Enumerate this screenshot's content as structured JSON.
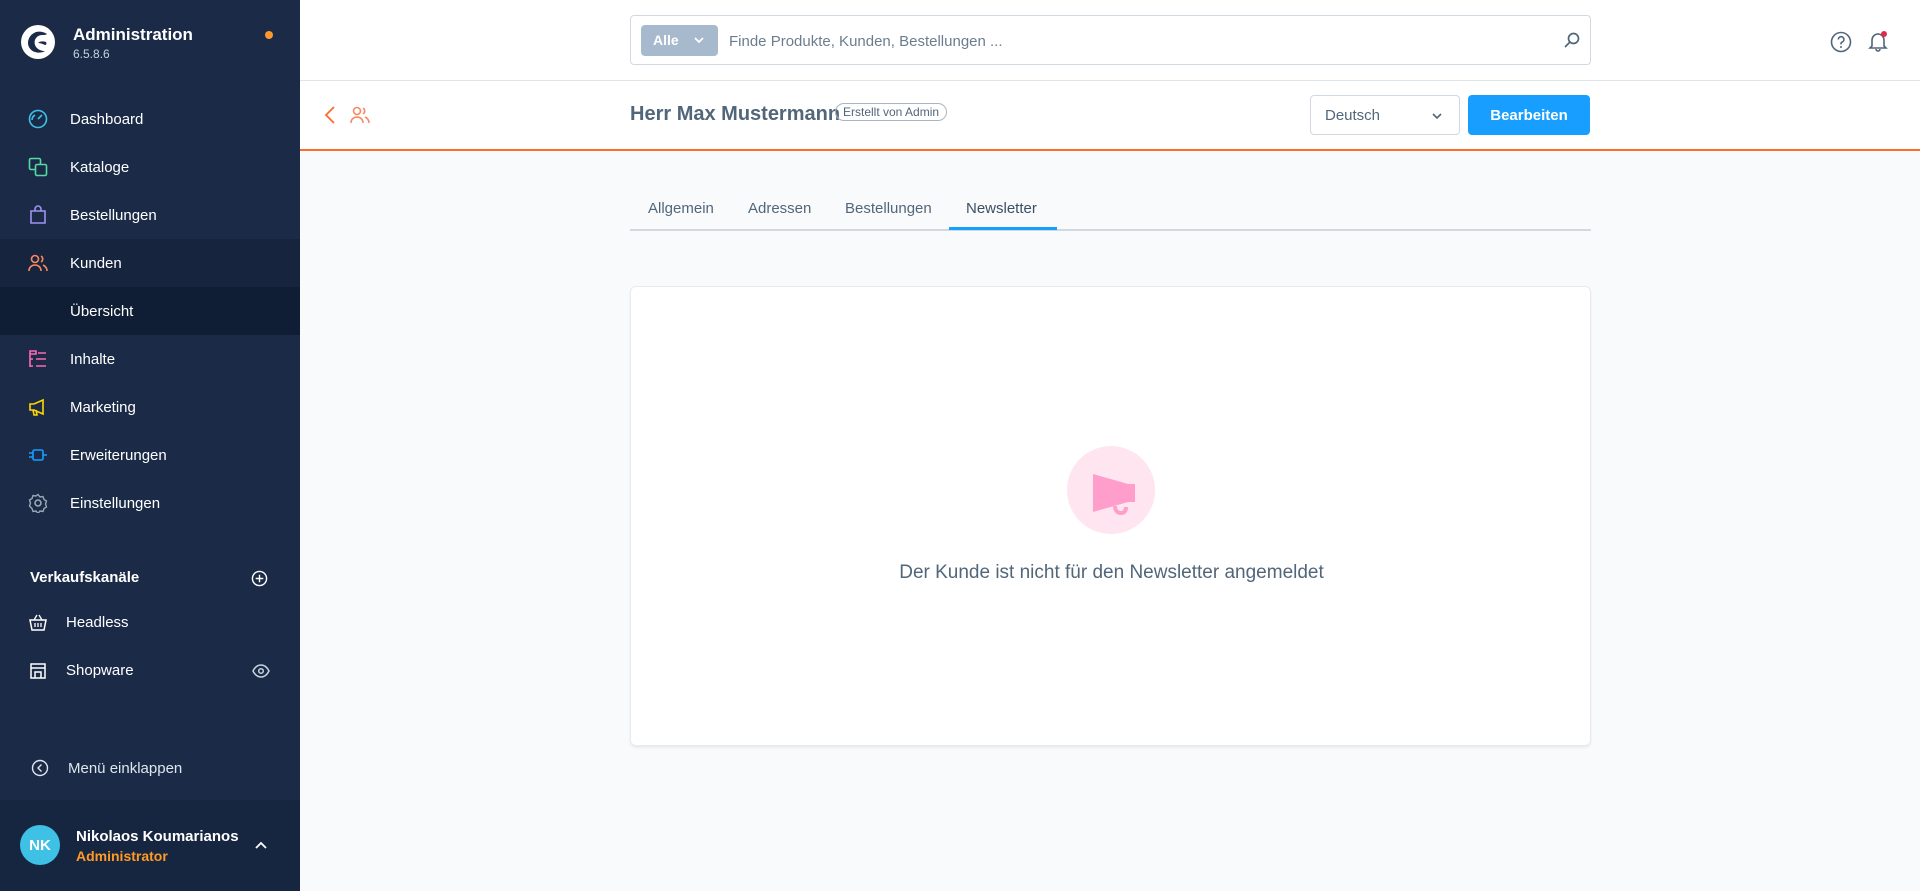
{
  "brand": {
    "title": "Administration",
    "version": "6.5.8.6"
  },
  "sidebar": {
    "items": [
      {
        "label": "Dashboard",
        "icon": "dashboard-icon",
        "color": "#3fc1e5"
      },
      {
        "label": "Kataloge",
        "icon": "catalog-icon",
        "color": "#57d9a3"
      },
      {
        "label": "Bestellungen",
        "icon": "orders-icon",
        "color": "#a092f0"
      },
      {
        "label": "Kunden",
        "icon": "customers-icon",
        "color": "#f88962"
      },
      {
        "label": "Übersicht",
        "icon": "",
        "color": ""
      },
      {
        "label": "Inhalte",
        "icon": "content-icon",
        "color": "#ff68b4"
      },
      {
        "label": "Marketing",
        "icon": "marketing-icon",
        "color": "#ffd700"
      },
      {
        "label": "Erweiterungen",
        "icon": "extensions-icon",
        "color": "#189eff"
      },
      {
        "label": "Einstellungen",
        "icon": "settings-icon",
        "color": "#9aa8b5"
      }
    ],
    "channels_title": "Verkaufskanäle",
    "channels": [
      {
        "label": "Headless",
        "icon": "basket-icon"
      },
      {
        "label": "Shopware",
        "icon": "storefront-icon"
      }
    ],
    "collapse_label": "Menü einklappen"
  },
  "user": {
    "initials": "NK",
    "name": "Nikolaos Koumarianos",
    "role": "Administrator"
  },
  "search": {
    "type_label": "Alle",
    "placeholder": "Finde Produkte, Kunden, Bestellungen ..."
  },
  "smartbar": {
    "title": "Herr Max Mustermann",
    "badge": "Erstellt von Admin",
    "language": "Deutsch",
    "edit_label": "Bearbeiten"
  },
  "tabs": [
    "Allgemein",
    "Adressen",
    "Bestellungen",
    "Newsletter"
  ],
  "active_tab": "Newsletter",
  "empty_state": {
    "text": "Der Kunde ist nicht für den Newsletter angemeldet",
    "icon": "megaphone-icon"
  },
  "colors": {
    "accent": "#189eff",
    "sidebar": "#1b2b47",
    "module": "#ff6b2b",
    "role": "#ff9b25"
  }
}
